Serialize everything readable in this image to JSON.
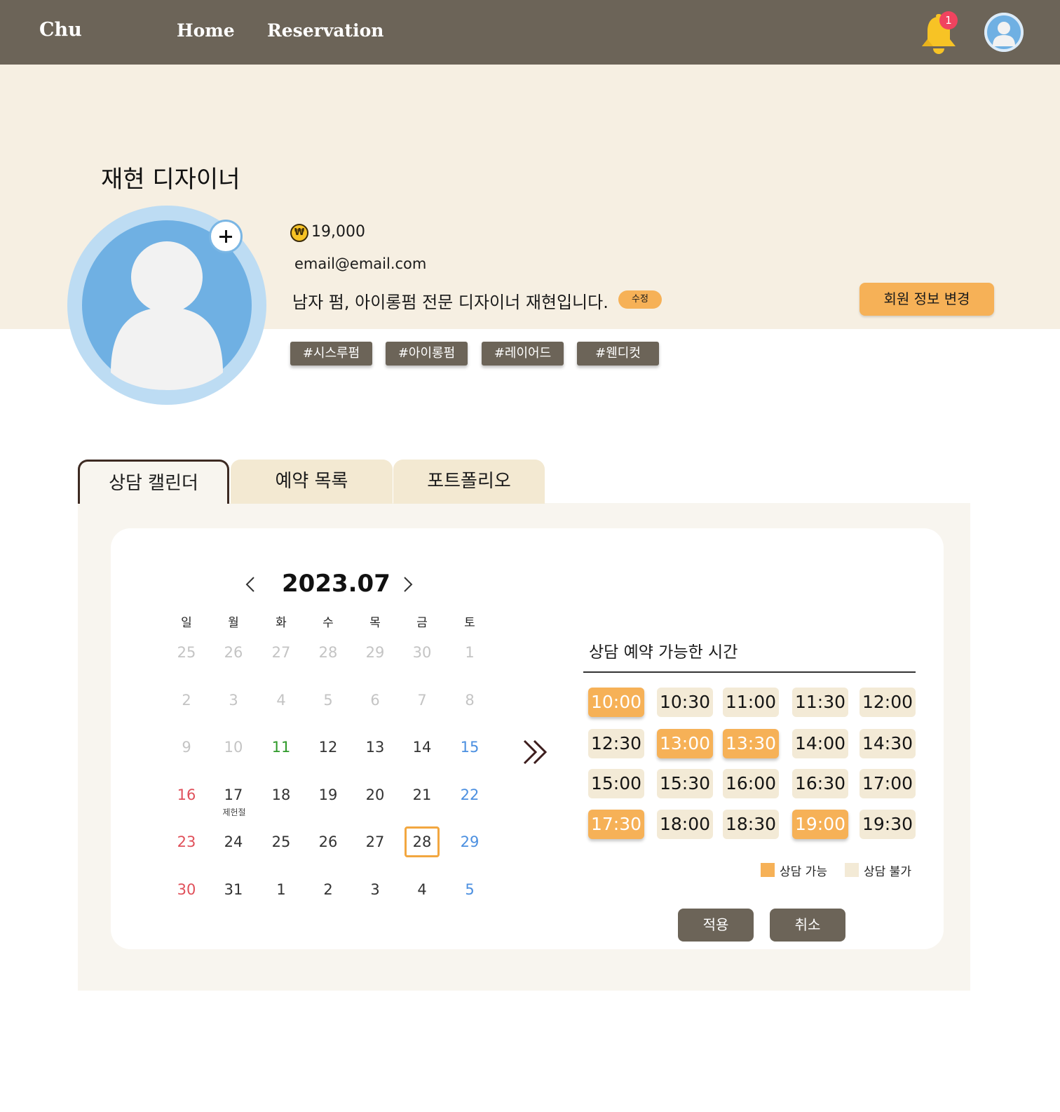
{
  "nav": {
    "brand": "Chu",
    "links": [
      "Home",
      "Reservation"
    ],
    "notification_count": "1",
    "icons": {
      "bell": "bell-icon",
      "profile": "user-avatar-icon"
    }
  },
  "profile": {
    "name": "재현 디자이너",
    "currency_symbol": "₩",
    "points": "19,000",
    "email": "email@email.com",
    "bio": "남자 펌, 아이롱펌 전문 디자이너 재현입니다.",
    "edit_label": "수정",
    "change_info_label": "회원 정보 변경",
    "tags": [
      "#시스루펌",
      "#아이롱펌",
      "#레이어드",
      "#웬디컷"
    ]
  },
  "tabs": [
    "상담 캘린더",
    "예약 목록",
    "포트폴리오"
  ],
  "calendar": {
    "title": "2023.07",
    "weekdays": [
      "일",
      "월",
      "화",
      "수",
      "목",
      "금",
      "토"
    ],
    "weeks": [
      [
        "25",
        "26",
        "27",
        "28",
        "29",
        "30",
        "1"
      ],
      [
        "2",
        "3",
        "4",
        "5",
        "6",
        "7",
        "8"
      ],
      [
        "9",
        "10",
        "11",
        "12",
        "13",
        "14",
        "15"
      ],
      [
        "16",
        "17",
        "18",
        "19",
        "20",
        "21",
        "22"
      ],
      [
        "23",
        "24",
        "25",
        "26",
        "27",
        "28",
        "29"
      ],
      [
        "30",
        "31",
        "1",
        "2",
        "3",
        "4",
        "5"
      ]
    ],
    "holiday_label": "제헌절",
    "selected_day": "28"
  },
  "slots": {
    "title": "상담 예약 가능한 시간",
    "times": [
      "10:00",
      "10:30",
      "11:00",
      "11:30",
      "12:00",
      "12:30",
      "13:00",
      "13:30",
      "14:00",
      "14:30",
      "15:00",
      "15:30",
      "16:00",
      "16:30",
      "17:00",
      "17:30",
      "18:00",
      "18:30",
      "19:00",
      "19:30"
    ],
    "available": [
      "10:00",
      "13:00",
      "13:30",
      "17:30",
      "19:00"
    ],
    "legend_available": "상담 가능",
    "legend_unavailable": "상담 불가",
    "apply_label": "적용",
    "cancel_label": "취소"
  },
  "colors": {
    "nav_bg": "#6c6458",
    "banner_bg": "#f6efe2",
    "accent": "#f6b157",
    "slot_unavailable": "#f3ead6",
    "sunday": "#e0505a",
    "saturday": "#4b8fe0",
    "today": "#2f9a2a"
  }
}
